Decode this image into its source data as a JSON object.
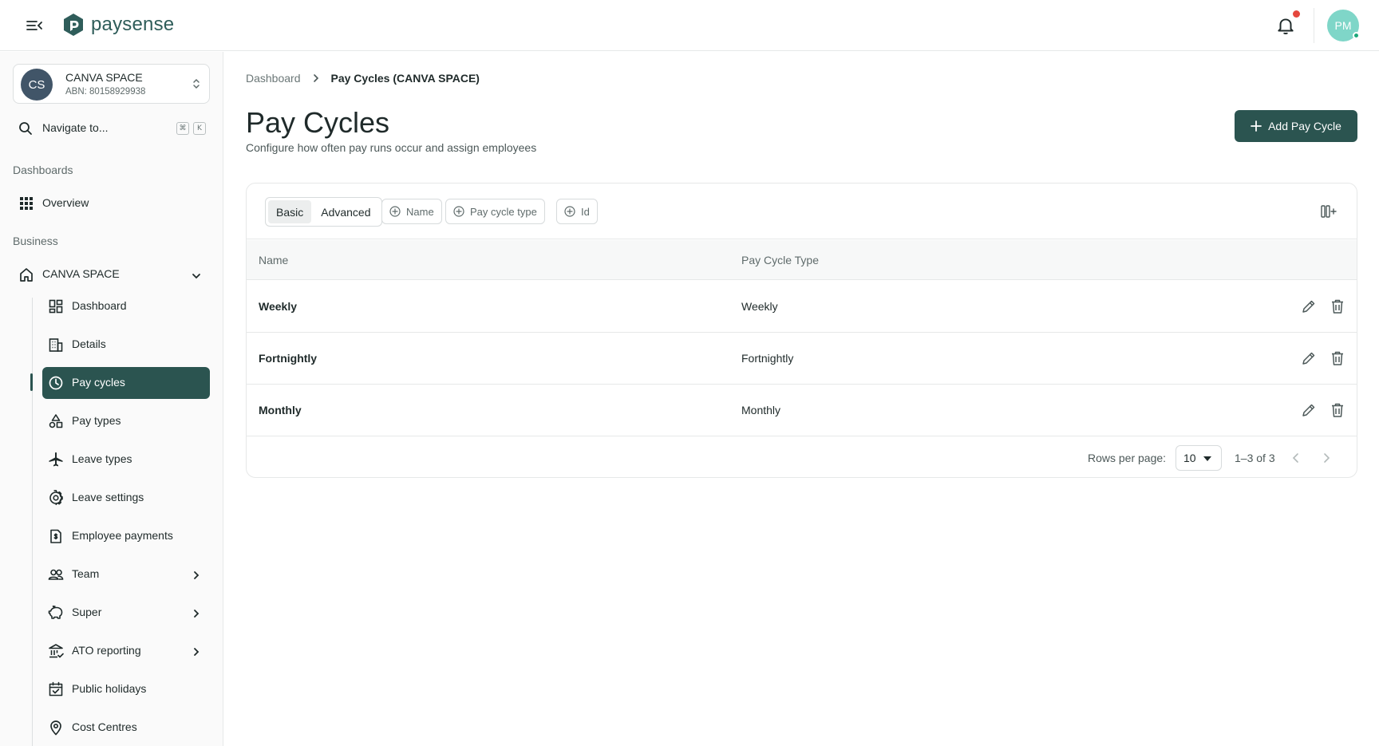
{
  "header": {
    "brand": "paysense",
    "user_initials": "PM"
  },
  "sidebar": {
    "org": {
      "initials": "CS",
      "name": "CANVA SPACE",
      "abn": "ABN: 80158929938"
    },
    "search": {
      "label": "Navigate to...",
      "shortcut_mod": "⌘",
      "shortcut_key": "K"
    },
    "section_dashboards": "Dashboards",
    "overview": "Overview",
    "section_business": "Business",
    "business_name": "CANVA SPACE",
    "items": [
      {
        "label": "Dashboard"
      },
      {
        "label": "Details"
      },
      {
        "label": "Pay cycles"
      },
      {
        "label": "Pay types"
      },
      {
        "label": "Leave types"
      },
      {
        "label": "Leave settings"
      },
      {
        "label": "Employee payments"
      },
      {
        "label": "Team"
      },
      {
        "label": "Super"
      },
      {
        "label": "ATO reporting"
      },
      {
        "label": "Public holidays"
      },
      {
        "label": "Cost Centres"
      }
    ]
  },
  "breadcrumb": {
    "root": "Dashboard",
    "current": "Pay Cycles (CANVA SPACE)"
  },
  "page": {
    "title": "Pay Cycles",
    "subtitle": "Configure how often pay runs occur and assign employees",
    "add_button": "Add Pay Cycle"
  },
  "filters": {
    "basic": "Basic",
    "advanced": "Advanced",
    "chips": [
      "Name",
      "Pay cycle type",
      "Id"
    ]
  },
  "table": {
    "columns": [
      "Name",
      "Pay Cycle Type"
    ],
    "rows": [
      {
        "name": "Weekly",
        "type": "Weekly"
      },
      {
        "name": "Fortnightly",
        "type": "Fortnightly"
      },
      {
        "name": "Monthly",
        "type": "Monthly"
      }
    ]
  },
  "pagination": {
    "rows_per_page_label": "Rows per page:",
    "rows_per_page": "10",
    "range": "1–3 of 3"
  },
  "colors": {
    "primary": "#2b5450",
    "avatar_user": "#7fd6c8",
    "avatar_org": "#415568",
    "notification": "#e5473d"
  }
}
